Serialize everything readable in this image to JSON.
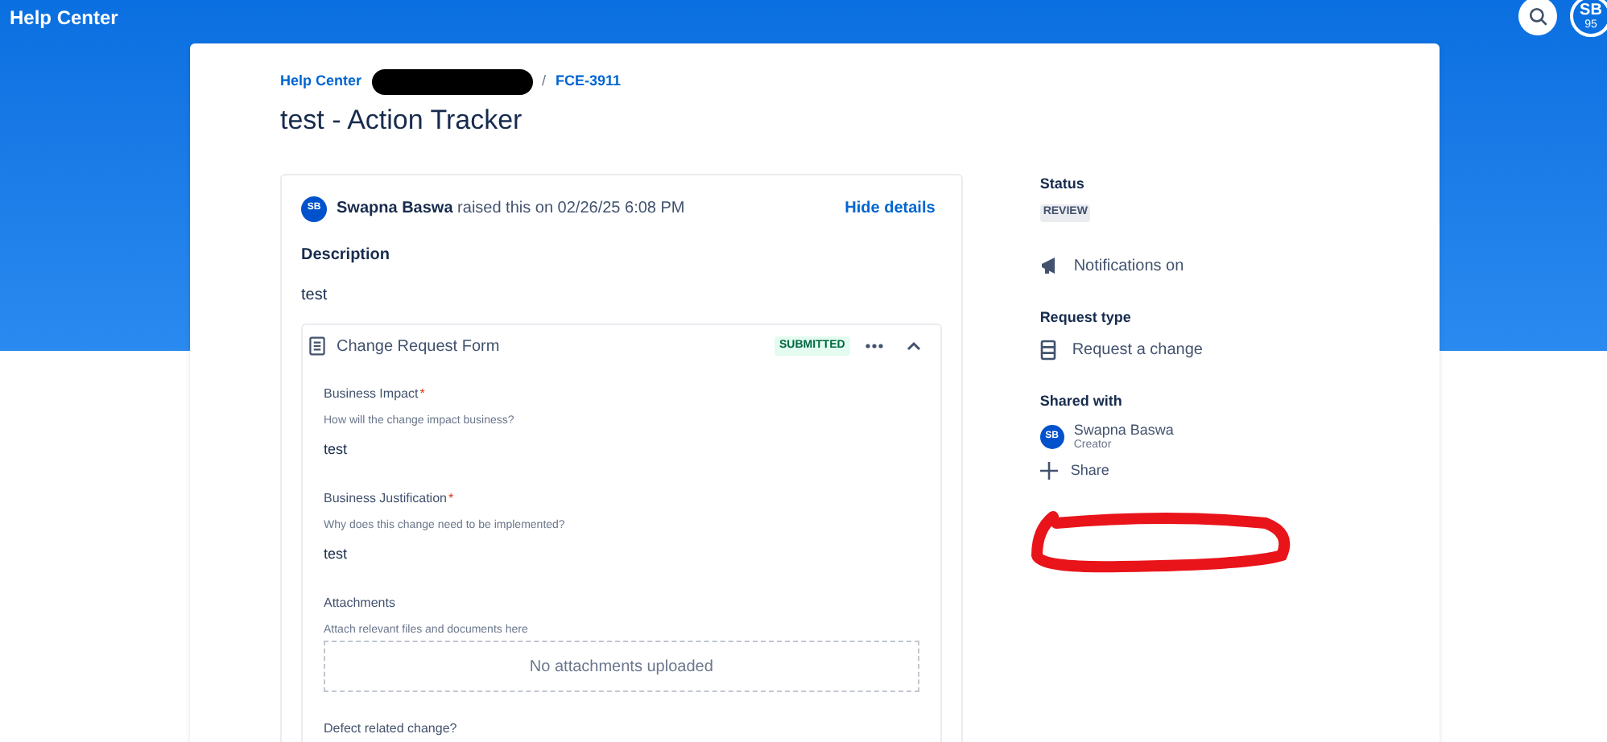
{
  "header": {
    "title": "Help Center",
    "avatar": "SB",
    "avatar_badge": "95"
  },
  "breadcrumbs": {
    "items": [
      "Help Center",
      "FCE-3911"
    ],
    "separator": "/"
  },
  "page_title": "test - Action Tracker",
  "activity": {
    "avatar": "SB",
    "author": "Swapna Baswa",
    "action": "raised this on 02/26/25 6:08 PM",
    "toggle": "Hide details",
    "description_label": "Description",
    "description": "test"
  },
  "form": {
    "title": "Change Request Form",
    "status": "SUBMITTED",
    "expanded": true,
    "fields": [
      {
        "kind": "text",
        "label": "Business Impact",
        "required_mark": "*",
        "hint": "How will the change impact business?",
        "value": "test"
      },
      {
        "kind": "text",
        "label": "Business Justification",
        "required_mark": "*",
        "hint": "Why does this change need to be implemented?",
        "value": "test"
      },
      {
        "kind": "attachments",
        "label": "Attachments",
        "hint": "Attach relevant files and documents here",
        "value": "No attachments uploaded"
      },
      {
        "kind": "text",
        "label": "Defect related change?"
      }
    ]
  },
  "sidebar": {
    "status_label": "Status",
    "status": "REVIEW",
    "notifications": "Notifications on",
    "request_type_label": "Request type",
    "request_type": "Request a change",
    "shared_label": "Shared with",
    "shared": [
      {
        "avatar": "SB",
        "name": "Swapna Baswa",
        "role": "Creator"
      }
    ],
    "share": "Share"
  }
}
